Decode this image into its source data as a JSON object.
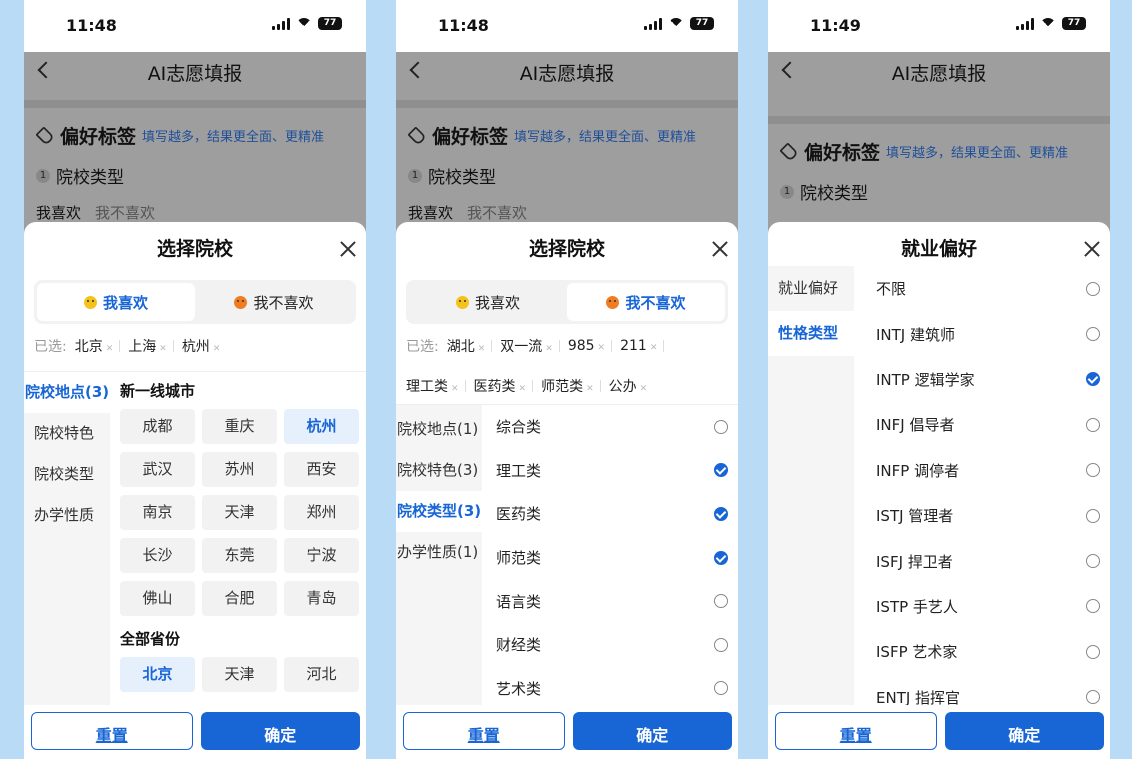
{
  "screens": [
    {
      "time": "11:48",
      "battery": "77",
      "nav_title": "AI志愿填报",
      "pref_title": "偏好标签",
      "pref_hint": "填写越多，结果更全面、更精准",
      "section_num": "1",
      "section_title": "院校类型",
      "likes_on": "我喜欢",
      "likes_off": "我不喜欢",
      "sheet_title": "选择院校",
      "seg_like": "我喜欢",
      "seg_dislike": "我不喜欢",
      "selected_label": "已选:",
      "selected": [
        "北京",
        "上海",
        "杭州"
      ],
      "left_items": [
        "院校地点(3)",
        "院校特色",
        "院校类型",
        "办学性质"
      ],
      "group1_title": "新一线城市",
      "group1_cells": [
        "成都",
        "重庆",
        "杭州",
        "武汉",
        "苏州",
        "西安",
        "南京",
        "天津",
        "郑州",
        "长沙",
        "东莞",
        "宁波",
        "佛山",
        "合肥",
        "青岛"
      ],
      "group2_title": "全部省份",
      "group2_cells": [
        "北京",
        "天津",
        "河北"
      ],
      "reset": "重置",
      "ok": "确定"
    },
    {
      "time": "11:48",
      "battery": "77",
      "nav_title": "AI志愿填报",
      "pref_title": "偏好标签",
      "pref_hint": "填写越多，结果更全面、更精准",
      "section_num": "1",
      "section_title": "院校类型",
      "likes_on": "我喜欢",
      "likes_off": "我不喜欢",
      "sheet_title": "选择院校",
      "seg_like": "我喜欢",
      "seg_dislike": "我不喜欢",
      "selected_label": "已选:",
      "selected_row1": [
        "湖北",
        "双一流",
        "985",
        "211"
      ],
      "selected_row2": [
        "理工类",
        "医药类",
        "师范类",
        "公办"
      ],
      "left_items": [
        "院校地点(1)",
        "院校特色(3)",
        "院校类型(3)",
        "办学性质(1)"
      ],
      "options": [
        {
          "label": "综合类",
          "checked": false
        },
        {
          "label": "理工类",
          "checked": true
        },
        {
          "label": "医药类",
          "checked": true
        },
        {
          "label": "师范类",
          "checked": true
        },
        {
          "label": "语言类",
          "checked": false
        },
        {
          "label": "财经类",
          "checked": false
        },
        {
          "label": "艺术类",
          "checked": false
        }
      ],
      "reset": "重置",
      "ok": "确定"
    },
    {
      "time": "11:49",
      "battery": "77",
      "nav_title": "AI志愿填报",
      "pref_title": "偏好标签",
      "pref_hint": "填写越多，结果更全面、更精准",
      "section_num": "1",
      "section_title": "院校类型",
      "sheet_title": "就业偏好",
      "left_items": [
        "就业偏好",
        "性格类型"
      ],
      "options": [
        {
          "label": "不限",
          "checked": false
        },
        {
          "label": "INTJ 建筑师",
          "checked": false
        },
        {
          "label": "INTP 逻辑学家",
          "checked": true
        },
        {
          "label": "INFJ 倡导者",
          "checked": false
        },
        {
          "label": "INFP 调停者",
          "checked": false
        },
        {
          "label": "ISTJ 管理者",
          "checked": false
        },
        {
          "label": "ISFJ 捍卫者",
          "checked": false
        },
        {
          "label": "ISTP 手艺人",
          "checked": false
        },
        {
          "label": "ISFP 艺术家",
          "checked": false
        },
        {
          "label": "ENTJ 指挥官",
          "checked": false
        }
      ],
      "reset": "重置",
      "ok": "确定"
    }
  ]
}
